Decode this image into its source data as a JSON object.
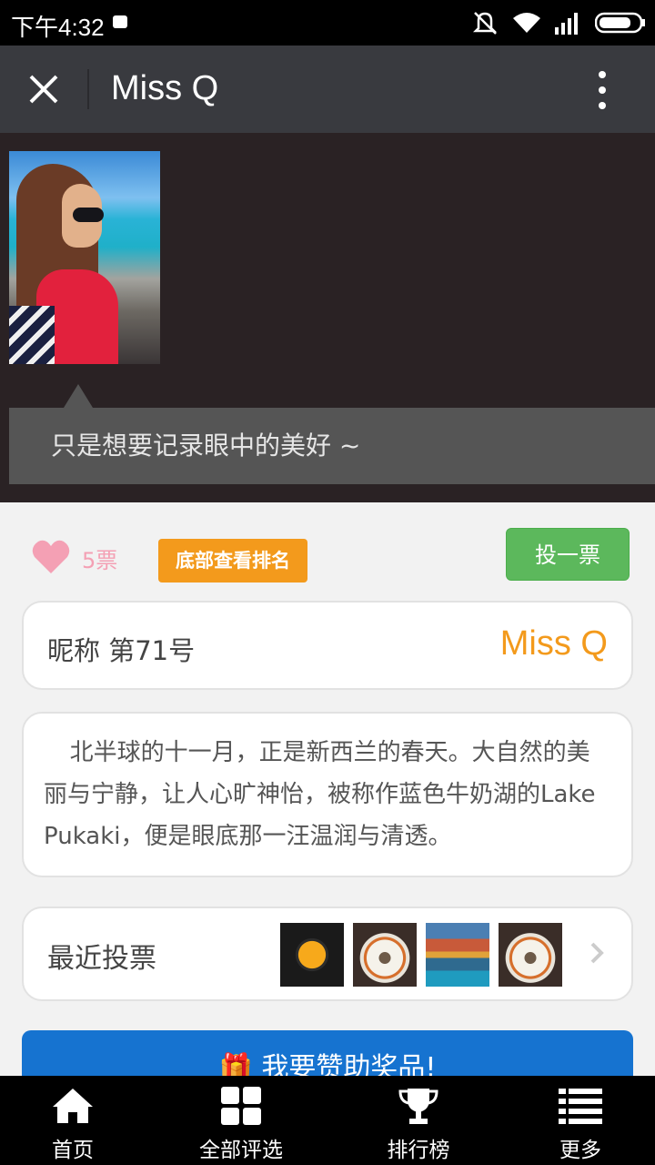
{
  "status_bar": {
    "time": "下午4:32"
  },
  "header": {
    "title": "Miss Q"
  },
  "profile": {
    "caption": "只是想要记录眼中的美好 ~"
  },
  "vote": {
    "count": "5票",
    "rank_badge": "底部查看排名",
    "vote_button": "投一票"
  },
  "nickname": {
    "label": "昵称 第71号",
    "value": "Miss Q"
  },
  "description": {
    "text": "北半球的十一月，正是新西兰的春天。大自然的美丽与宁静，让人心旷神怡，被称作蓝色牛奶湖的Lake Pukaki，便是眼底那一汪温润与清透。"
  },
  "recent_votes": {
    "label": "最近投票"
  },
  "sponsor_button": {
    "label": "我要赞助奖品!"
  },
  "tabs": [
    {
      "label": "首页",
      "icon": "home-icon"
    },
    {
      "label": "全部评选",
      "icon": "grid-icon"
    },
    {
      "label": "排行榜",
      "icon": "trophy-icon"
    },
    {
      "label": "更多",
      "icon": "list-icon"
    }
  ],
  "colors": {
    "accent_orange": "#f39a1c",
    "vote_green": "#5cb85c",
    "heart_pink": "#f4a0b4",
    "sponsor_blue": "#1673d0"
  }
}
